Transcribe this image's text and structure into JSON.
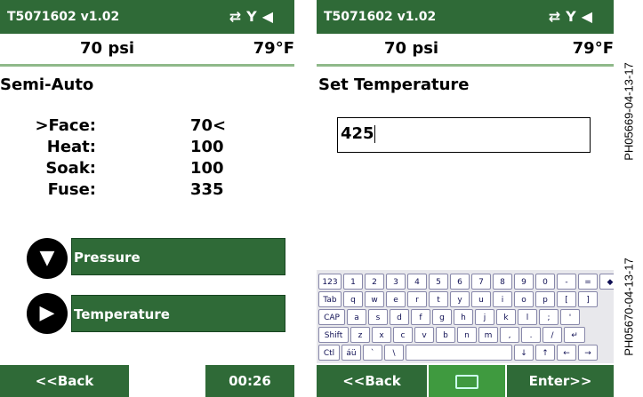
{
  "screen1": {
    "title": "T5071602 v1.02",
    "status_icons": [
      "sync-icon",
      "antenna-no-signal-icon",
      "speaker-icon"
    ],
    "pressure": "70 psi",
    "temperature": "79°F",
    "heading": "Semi-Auto",
    "rows": [
      {
        "label": ">Face:",
        "value": "70<"
      },
      {
        "label": "Heat:",
        "value": "100"
      },
      {
        "label": "Soak:",
        "value": "100"
      },
      {
        "label": "Fuse:",
        "value": "335"
      }
    ],
    "pressure_button": "Pressure",
    "temperature_button": "Temperature",
    "back": "<<Back",
    "timer": "00:26"
  },
  "screen2": {
    "title": "T5071602 v1.02",
    "status_icons": [
      "sync-icon",
      "antenna-no-signal-icon",
      "speaker-icon"
    ],
    "pressure": "70 psi",
    "temperature": "79°F",
    "heading": "Set Temperature",
    "input_value": "425",
    "back": "<<Back",
    "enter": "Enter>>",
    "keyboard_rows": [
      [
        "123",
        "1",
        "2",
        "3",
        "4",
        "5",
        "6",
        "7",
        "8",
        "9",
        "0",
        "-",
        "=",
        "◆"
      ],
      [
        "Tab",
        "q",
        "w",
        "e",
        "r",
        "t",
        "y",
        "u",
        "i",
        "o",
        "p",
        "[",
        "]"
      ],
      [
        "CAP",
        "a",
        "s",
        "d",
        "f",
        "g",
        "h",
        "j",
        "k",
        "l",
        ";",
        "'"
      ],
      [
        "Shift",
        "z",
        "x",
        "c",
        "v",
        "b",
        "n",
        "m",
        ",",
        ".",
        "/",
        "↵"
      ],
      [
        "Ctl",
        "áü",
        "`",
        "\\",
        " ",
        "↓",
        "↑",
        "←",
        "→"
      ]
    ]
  },
  "side_labels": [
    "PH05669-04-13-17",
    "PH05670-04-13-17"
  ]
}
